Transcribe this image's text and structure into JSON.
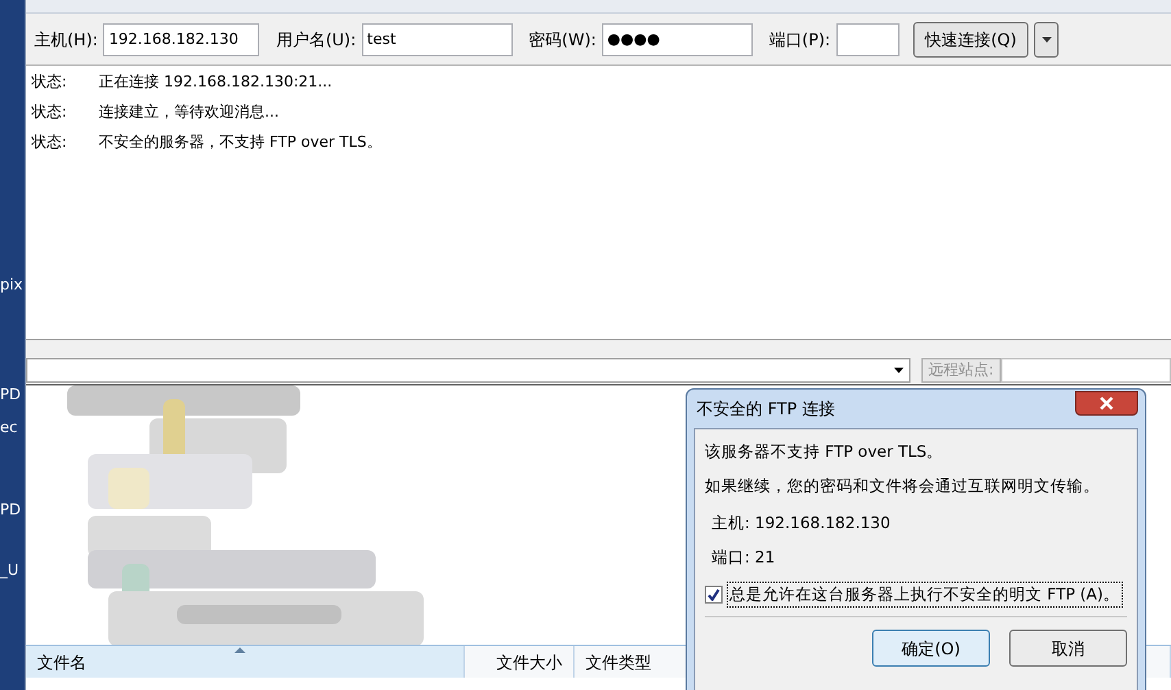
{
  "desktop": {
    "labels": [
      "pix",
      "PD",
      "ec",
      "PD",
      "_U"
    ]
  },
  "quickconnect": {
    "fields": [
      {
        "label": "主机(H):",
        "value": "192.168.182.130"
      },
      {
        "label": "用户名(U):",
        "value": "test"
      },
      {
        "label": "密码(W):",
        "value": "●●●●"
      },
      {
        "label": "端口(P):"
      }
    ],
    "button": "快速连接(Q)"
  },
  "log": [
    {
      "tag": "状态:",
      "message": "正在连接 192.168.182.130:21..."
    },
    {
      "tag": "状态:",
      "message": "连接建立，等待欢迎消息..."
    },
    {
      "tag": "状态:",
      "message": "不安全的服务器，不支持 FTP over TLS。"
    }
  ],
  "remote_site": {
    "label": "远程站点:"
  },
  "file_list": {
    "columns": [
      {
        "label": "文件名",
        "sorted": true
      },
      {
        "label": "文件大小",
        "sorted": false
      },
      {
        "label": "文件类型",
        "sorted": false
      }
    ]
  },
  "dialog": {
    "title": "不安全的 FTP 连接",
    "lines": [
      "该服务器不支持 FTP over TLS。",
      "如果继续，您的密码和文件将会通过互联网明文传输。"
    ],
    "details": [
      "主机: 192.168.182.130",
      "端口: 21"
    ],
    "checkbox": {
      "label": "总是允许在这台服务器上执行不安全的明文 FTP (A)。",
      "checked": true
    },
    "buttons": [
      "确定(O)",
      "取消"
    ]
  }
}
